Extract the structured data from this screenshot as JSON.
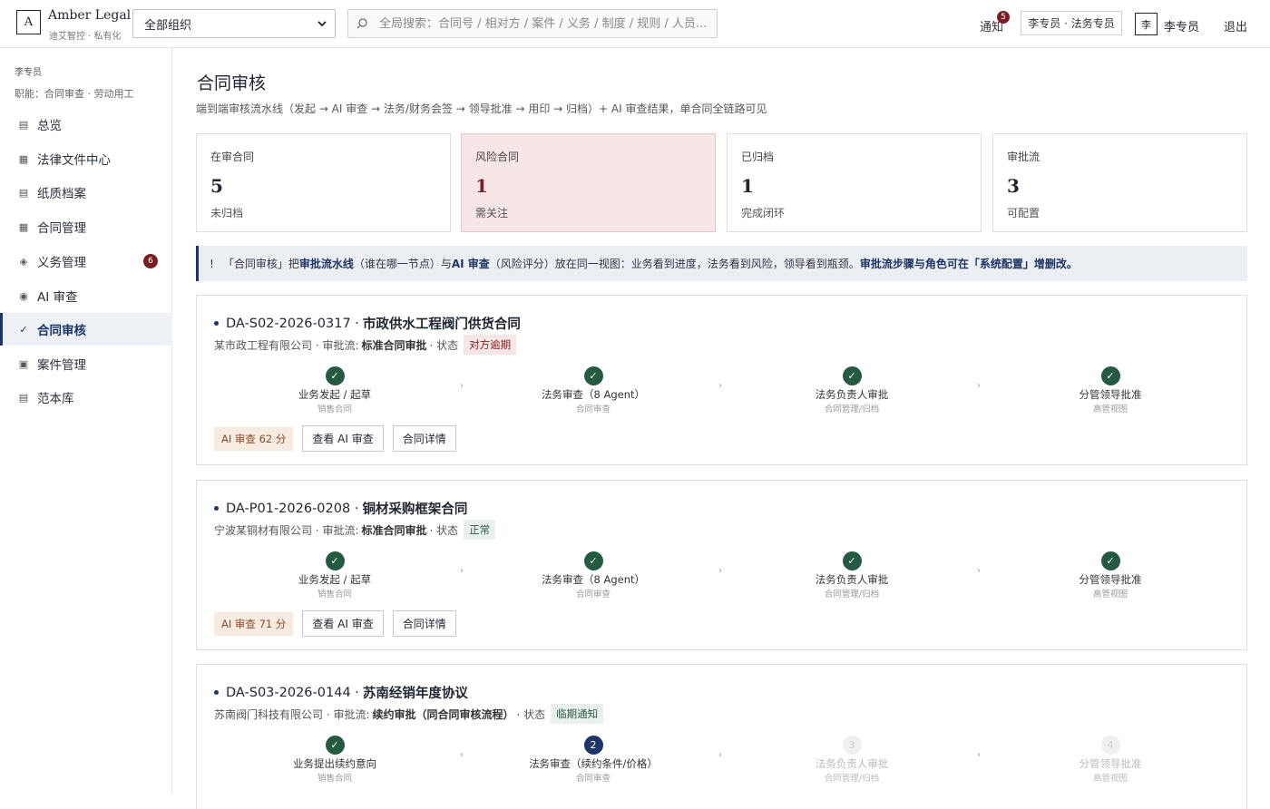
{
  "header": {
    "logo_letter": "A",
    "brand_name": "Amber Legal",
    "brand_sub": "迪艾智控 · 私有化",
    "org_select": "全部组织",
    "search_placeholder": "全局搜索：合同号 / 相对方 / 案件 / 义务 / 制度 / 规则 / 人员...",
    "notifications_label": "通知",
    "notifications_count": "5",
    "role_chip": "李专员 · 法务专员",
    "avatar_text": "李",
    "user_name": "李专员",
    "logout_label": "退出"
  },
  "sidebar": {
    "user": "李专员",
    "role": "职能：合同审查 · 劳动用工",
    "items": [
      {
        "icon": "▤",
        "label": "总览"
      },
      {
        "icon": "▦",
        "label": "法律文件中心"
      },
      {
        "icon": "▤",
        "label": "纸质档案"
      },
      {
        "icon": "▦",
        "label": "合同管理"
      },
      {
        "icon": "◈",
        "label": "义务管理",
        "badge": "6"
      },
      {
        "icon": "◉",
        "label": "AI 审查"
      },
      {
        "icon": "✓",
        "label": "合同审核",
        "active": true
      },
      {
        "icon": "▣",
        "label": "案件管理"
      },
      {
        "icon": "▤",
        "label": "范本库"
      }
    ]
  },
  "main": {
    "title": "合同审核",
    "subtitle": "端到端审核流水线（发起 → AI 审查 → 法务/财务会签 → 领导批准 → 用印 → 归档）+ AI 审查结果，单合同全链路可见",
    "stats": [
      {
        "label": "在审合同",
        "value": "5",
        "note": "未归档"
      },
      {
        "label": "风险合同",
        "value": "1",
        "note": "需关注"
      },
      {
        "label": "已归档",
        "value": "1",
        "note": "完成闭环"
      },
      {
        "label": "审批流",
        "value": "3",
        "note": "可配置"
      }
    ],
    "banner": {
      "icon": "!",
      "t1": "「合同审核」把",
      "b1": "审批流水线",
      "t2": "（谁在哪一节点）与",
      "b2": "AI 审查",
      "t3": "（风险评分）放在同一视图：业务看到进度，法务看到风险，领导看到瓶颈。",
      "b3": "审批流步骤与角色可在「系统配置」增删改。"
    },
    "cards": [
      {
        "code": "DA-S02-2026-0317 ·",
        "title": "市政供水工程阀门供货合同",
        "company": "某市政工程有限公司 · 审批流:",
        "flow": "标准合同审批",
        "status_prefix": "· 状态",
        "status": "对方逾期",
        "steps": [
          {
            "mark": "✓",
            "name": "业务发起 / 起草",
            "sub": "销售合同"
          },
          {
            "mark": "✓",
            "name": "法务审查（8 Agent）",
            "sub": "合同审查"
          },
          {
            "mark": "✓",
            "name": "法务负责人审批",
            "sub": "合同管理/归档"
          },
          {
            "mark": "✓",
            "name": "分管领导批准",
            "sub": "高管视图"
          }
        ],
        "arrow": "›",
        "ai_score": "AI 审查 62 分",
        "btn_ai": "查看 AI 审查",
        "btn_detail": "合同详情"
      },
      {
        "code": "DA-P01-2026-0208 ·",
        "title": "铜材采购框架合同",
        "company": "宁波某铜材有限公司 · 审批流:",
        "flow": "标准合同审批",
        "status_prefix": "· 状态",
        "status": "正常",
        "steps": [
          {
            "mark": "✓",
            "name": "业务发起 / 起草",
            "sub": "销售合同"
          },
          {
            "mark": "✓",
            "name": "法务审查（8 Agent）",
            "sub": "合同审查"
          },
          {
            "mark": "✓",
            "name": "法务负责人审批",
            "sub": "合同管理/归档"
          },
          {
            "mark": "✓",
            "name": "分管领导批准",
            "sub": "高管视图"
          }
        ],
        "arrow": "›",
        "ai_score": "AI 审查 71 分",
        "btn_ai": "查看 AI 审查",
        "btn_detail": "合同详情"
      },
      {
        "code": "DA-S03-2026-0144 ·",
        "title": "苏南经销年度协议",
        "company": "苏南阀门科技有限公司 · 审批流:",
        "flow": "续约审批（同合同审核流程）",
        "status_prefix": "· 状态",
        "status": "临期通知",
        "steps": [
          {
            "mark": "✓",
            "name": "业务提出续约意向",
            "sub": "销售合同"
          },
          {
            "mark": "2",
            "name": "法务审查（续约条件/价格）",
            "sub": "合同审查"
          },
          {
            "mark": "3",
            "name": "法务负责人审批",
            "sub": "合同管理/归档"
          },
          {
            "mark": "4",
            "name": "分管领导批准",
            "sub": "高管视图"
          }
        ],
        "arrow": "›"
      }
    ]
  }
}
